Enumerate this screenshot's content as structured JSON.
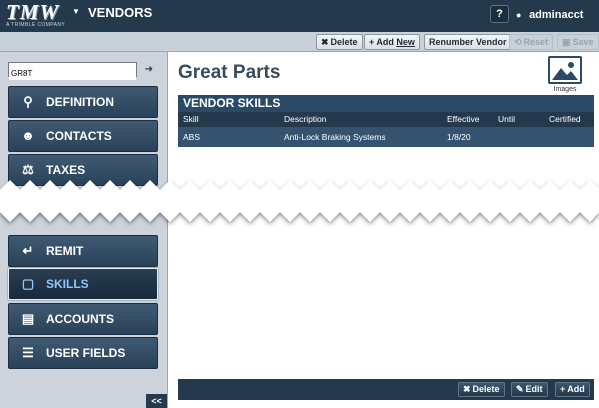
{
  "header": {
    "logo_text": "TMW",
    "logo_subtext": "A TRIMBLE COMPANY",
    "app_title": "VENDORS",
    "help_label": "?",
    "username": "adminacct"
  },
  "toolbar": {
    "delete_label": "Delete",
    "add_prefix": "+ Add ",
    "add_underlined": "New",
    "renumber_label": "Renumber Vendor",
    "reset_label": "Reset",
    "save_label": "Save"
  },
  "sidebar": {
    "search_value": "GR8T",
    "items": [
      {
        "label": "DEFINITION",
        "icon": "search-icon",
        "active": false
      },
      {
        "label": "CONTACTS",
        "icon": "person-icon",
        "active": false
      },
      {
        "label": "TAXES",
        "icon": "scales-icon",
        "active": false
      },
      {
        "label": "REMIT",
        "icon": "return-arrow-icon",
        "active": false
      },
      {
        "label": "SKILLS",
        "icon": "toolbox-icon",
        "active": true
      },
      {
        "label": "ACCOUNTS",
        "icon": "card-icon",
        "active": false
      },
      {
        "label": "USER FIELDS",
        "icon": "list-icon",
        "active": false
      }
    ],
    "collapse_label": "<<"
  },
  "main": {
    "title": "Great Parts",
    "images_label": "Images",
    "panel_title": "VENDOR SKILLS",
    "columns": [
      "Skill",
      "Description",
      "Effective",
      "Until",
      "Certified"
    ],
    "rows": [
      {
        "skill": "ABS",
        "description": "Anti-Lock Braking Systems",
        "effective": "1/8/20",
        "until": "",
        "certified": ""
      }
    ]
  },
  "bottom_bar": {
    "delete_label": "Delete",
    "edit_label": "Edit",
    "add_label": "Add"
  },
  "colors": {
    "header_bg": "#24394c",
    "nav_bg": "#35506a",
    "active_text": "#8fc4ff"
  }
}
